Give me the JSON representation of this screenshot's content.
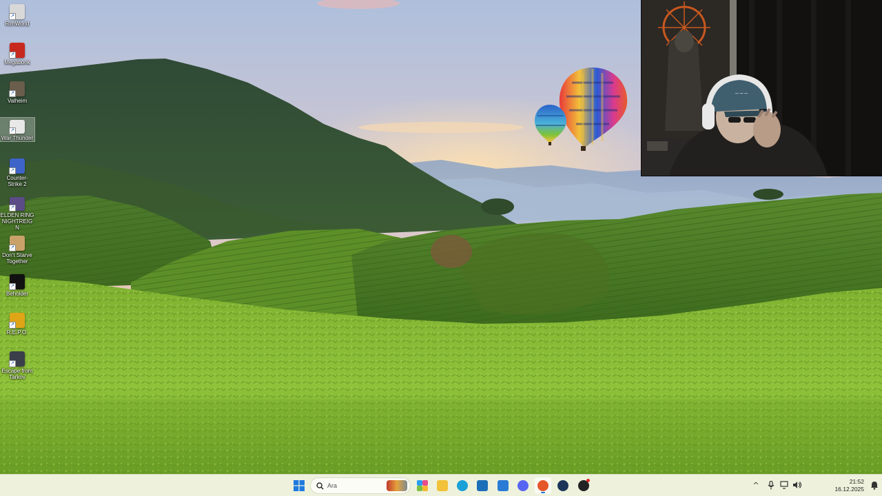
{
  "desktop_icons": [
    {
      "label": "RimWorld",
      "icon": "rimworld-icon",
      "color": "#d8d8d8"
    },
    {
      "label": "Megabonk",
      "icon": "megabonk-icon",
      "color": "#c8291f"
    },
    {
      "label": "Valheim",
      "icon": "valheim-icon",
      "color": "#6a5d4b"
    },
    {
      "label": "War Thunder",
      "icon": "war-thunder-icon",
      "color": "#e8e8e8"
    },
    {
      "label": "Counter-Strike 2",
      "icon": "counter-strike-2-icon",
      "color": "#3e63c9"
    },
    {
      "label": "ELDEN RING NIGHTREIGN",
      "icon": "elden-ring-nightreign-icon",
      "color": "#5b4b86"
    },
    {
      "label": "Don't Starve Together",
      "icon": "dont-starve-together-icon",
      "color": "#c9a26a"
    },
    {
      "label": "Beholder",
      "icon": "beholder-icon",
      "color": "#111111"
    },
    {
      "label": "R.E.P.O.",
      "icon": "repo-icon",
      "color": "#e0a517"
    },
    {
      "label": "Escape from Tarkov",
      "icon": "escape-from-tarkov-icon",
      "color": "#3a3f4a"
    }
  ],
  "selected_icon": "War Thunder",
  "taskbar": {
    "search_placeholder": "Ara",
    "apps": [
      {
        "name": "start-button",
        "icon": "windows-start-icon",
        "color": "#1f7adf"
      },
      {
        "name": "file-explorer-button",
        "icon": "folder-icon",
        "color": "#f2c23a"
      },
      {
        "name": "edge-button",
        "icon": "edge-icon",
        "color": "#1ba0d8"
      },
      {
        "name": "store-button",
        "icon": "store-icon",
        "color": "#1b6fb8"
      },
      {
        "name": "outlook-button",
        "icon": "outlook-icon",
        "color": "#2a7bd5"
      },
      {
        "name": "discord-button",
        "icon": "discord-icon",
        "color": "#5865f2"
      },
      {
        "name": "firefox-button",
        "icon": "firefox-icon",
        "color": "#e5572b"
      },
      {
        "name": "steam-button",
        "icon": "steam-icon",
        "color": "#1b3559"
      },
      {
        "name": "steelseries-button",
        "icon": "steelseries-icon",
        "color": "#222222"
      }
    ],
    "clock_time": "21:52",
    "clock_date": "16.12.2025"
  },
  "colors": {
    "taskbar_bg": "#eef2dc",
    "accent": "#1f7adf"
  }
}
